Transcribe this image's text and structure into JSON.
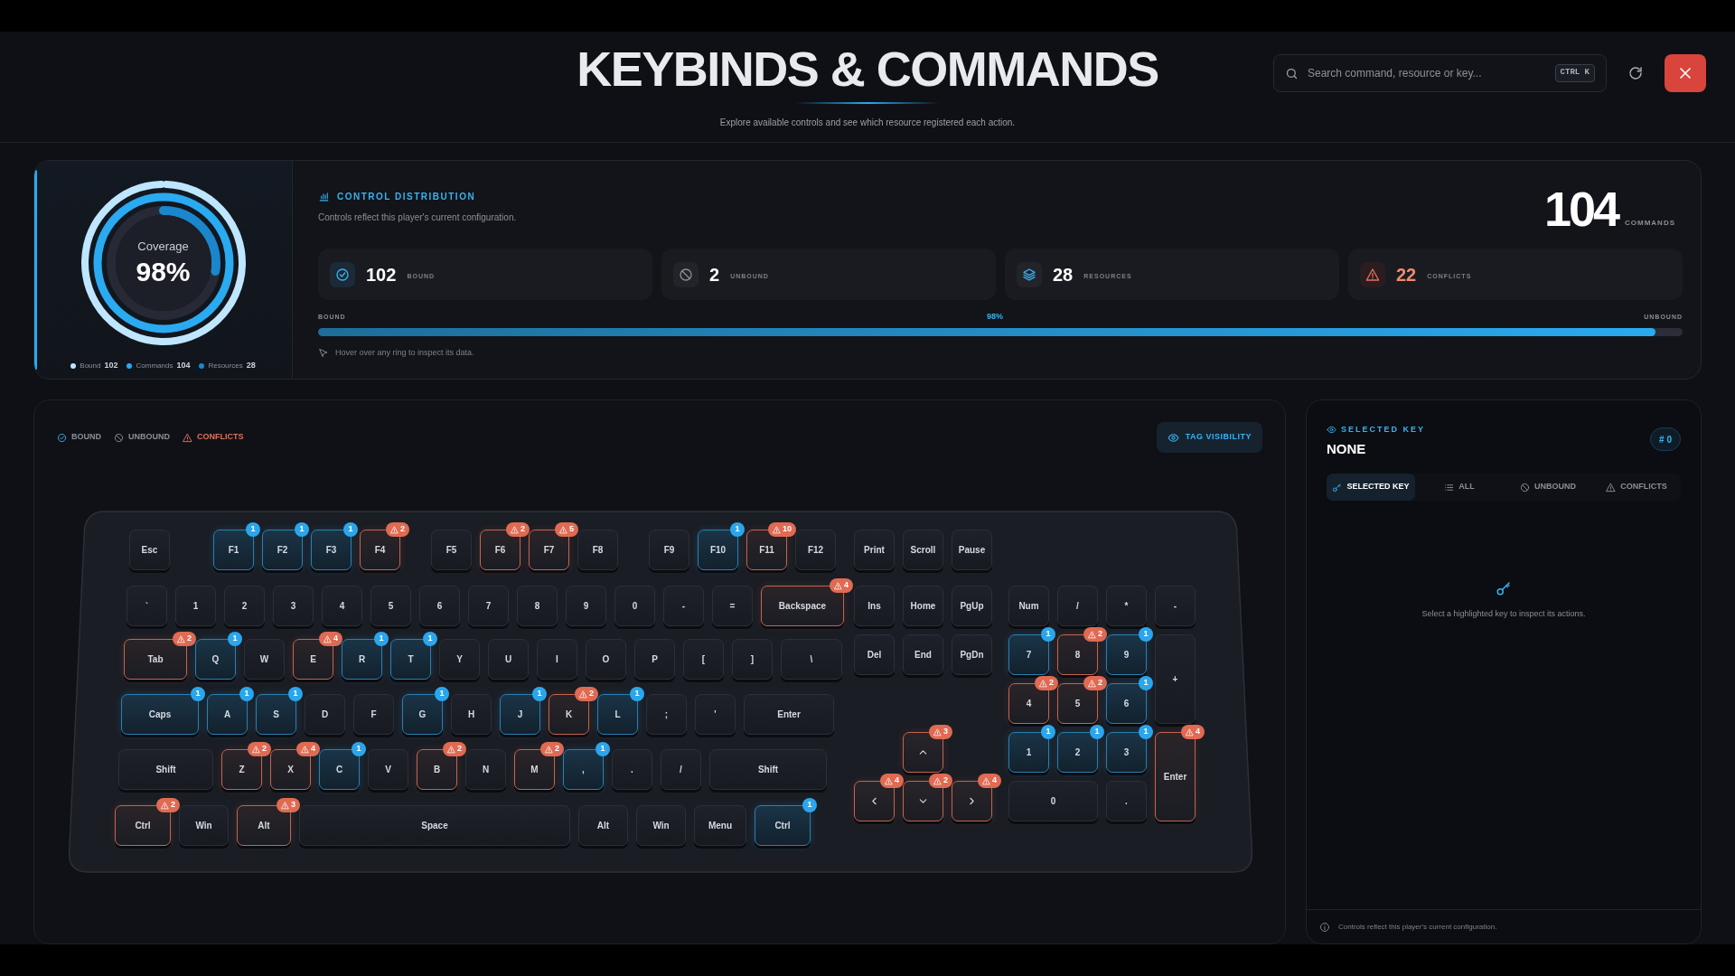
{
  "header": {
    "title": "KEYBINDS & COMMANDS",
    "subtitle": "Explore available controls and see which resource registered each action.",
    "search": {
      "placeholder": "Search command, resource or key...",
      "shortcut": "CTRL K"
    }
  },
  "overview": {
    "coverage": {
      "label": "Coverage",
      "value": "98%"
    },
    "legend": [
      {
        "label": "Bound",
        "value": "102",
        "color": "#bfe6ff"
      },
      {
        "label": "Commands",
        "value": "104",
        "color": "#2aaaf0"
      },
      {
        "label": "Resources",
        "value": "28",
        "color": "#1a86cc"
      }
    ],
    "title": "CONTROL DISTRIBUTION",
    "subtitle": "Controls reflect this player's current configuration.",
    "total": {
      "value": "104",
      "label": "COMMANDS"
    },
    "stats": [
      {
        "kind": "bound",
        "value": "102",
        "label": "BOUND"
      },
      {
        "kind": "unbound",
        "value": "2",
        "label": "UNBOUND"
      },
      {
        "kind": "resources",
        "value": "28",
        "label": "RESOURCES"
      },
      {
        "kind": "conflicts",
        "value": "22",
        "label": "CONFLICTS"
      }
    ],
    "progress": {
      "start_label": "BOUND",
      "reading": "98%",
      "end_label": "UNBOUND",
      "level": 0.98
    },
    "hint": "Hover over any ring to inspect its data."
  },
  "keyboard": {
    "legend": [
      {
        "kind": "bound",
        "label": "BOUND"
      },
      {
        "kind": "unbound",
        "label": "UNBOUND"
      },
      {
        "kind": "conflicts",
        "label": "CONFLICTS"
      }
    ],
    "tag_button": "TAG VISIBILITY",
    "main_rows": [
      [
        {
          "label": "Esc",
          "kind": "none"
        },
        {
          "label": "F1",
          "kind": "bound",
          "count": "1"
        },
        {
          "label": "F2",
          "kind": "bound",
          "count": "1"
        },
        {
          "label": "F3",
          "kind": "bound",
          "count": "1"
        },
        {
          "label": "F4",
          "kind": "conflict",
          "count": "2"
        },
        {
          "label": "F5",
          "kind": "none"
        },
        {
          "label": "F6",
          "kind": "conflict",
          "count": "2"
        },
        {
          "label": "F7",
          "kind": "conflict",
          "count": "5"
        },
        {
          "label": "F8",
          "kind": "none"
        },
        {
          "label": "F9",
          "kind": "none"
        },
        {
          "label": "F10",
          "kind": "bound",
          "count": "1"
        },
        {
          "label": "F11",
          "kind": "conflict",
          "count": "10"
        },
        {
          "label": "F12",
          "kind": "none"
        }
      ],
      [
        {
          "label": "`",
          "kind": "none"
        },
        {
          "label": "1",
          "kind": "none"
        },
        {
          "label": "2",
          "kind": "none"
        },
        {
          "label": "3",
          "kind": "none"
        },
        {
          "label": "4",
          "kind": "none"
        },
        {
          "label": "5",
          "kind": "none"
        },
        {
          "label": "6",
          "kind": "none"
        },
        {
          "label": "7",
          "kind": "none"
        },
        {
          "label": "8",
          "kind": "none"
        },
        {
          "label": "9",
          "kind": "none"
        },
        {
          "label": "0",
          "kind": "none"
        },
        {
          "label": "-",
          "kind": "none"
        },
        {
          "label": "=",
          "kind": "none"
        },
        {
          "label": "Backspace",
          "kind": "conflict",
          "count": "4"
        }
      ],
      [
        {
          "label": "Tab",
          "kind": "conflict",
          "count": "2"
        },
        {
          "label": "Q",
          "kind": "bound",
          "count": "1"
        },
        {
          "label": "W",
          "kind": "none"
        },
        {
          "label": "E",
          "kind": "conflict",
          "count": "4"
        },
        {
          "label": "R",
          "kind": "bound",
          "count": "1"
        },
        {
          "label": "T",
          "kind": "bound",
          "count": "1"
        },
        {
          "label": "Y",
          "kind": "none"
        },
        {
          "label": "U",
          "kind": "none"
        },
        {
          "label": "I",
          "kind": "none"
        },
        {
          "label": "O",
          "kind": "none"
        },
        {
          "label": "P",
          "kind": "none"
        },
        {
          "label": "[",
          "kind": "none"
        },
        {
          "label": "]",
          "kind": "none"
        },
        {
          "label": "\\",
          "kind": "none"
        }
      ],
      [
        {
          "label": "Caps",
          "kind": "bound",
          "count": "1"
        },
        {
          "label": "A",
          "kind": "bound",
          "count": "1"
        },
        {
          "label": "S",
          "kind": "bound",
          "count": "1"
        },
        {
          "label": "D",
          "kind": "none"
        },
        {
          "label": "F",
          "kind": "none"
        },
        {
          "label": "G",
          "kind": "bound",
          "count": "1"
        },
        {
          "label": "H",
          "kind": "none"
        },
        {
          "label": "J",
          "kind": "bound",
          "count": "1"
        },
        {
          "label": "K",
          "kind": "conflict",
          "count": "2"
        },
        {
          "label": "L",
          "kind": "bound",
          "count": "1"
        },
        {
          "label": ";",
          "kind": "none"
        },
        {
          "label": "'",
          "kind": "none"
        },
        {
          "label": "Enter",
          "kind": "none"
        }
      ],
      [
        {
          "label": "Shift",
          "kind": "none"
        },
        {
          "label": "Z",
          "kind": "conflict",
          "count": "2"
        },
        {
          "label": "X",
          "kind": "conflict",
          "count": "4"
        },
        {
          "label": "C",
          "kind": "bound",
          "count": "1"
        },
        {
          "label": "V",
          "kind": "none"
        },
        {
          "label": "B",
          "kind": "conflict",
          "count": "2"
        },
        {
          "label": "N",
          "kind": "none"
        },
        {
          "label": "M",
          "kind": "conflict",
          "count": "2"
        },
        {
          "label": ",",
          "kind": "bound",
          "count": "1"
        },
        {
          "label": ".",
          "kind": "none"
        },
        {
          "label": "/",
          "kind": "none"
        },
        {
          "label": "Shift",
          "kind": "none"
        }
      ],
      [
        {
          "label": "Ctrl",
          "kind": "conflict",
          "count": "2"
        },
        {
          "label": "Win",
          "kind": "none"
        },
        {
          "label": "Alt",
          "kind": "conflict",
          "count": "3"
        },
        {
          "label": "Space",
          "kind": "none"
        },
        {
          "label": "Alt",
          "kind": "none"
        },
        {
          "label": "Win",
          "kind": "none"
        },
        {
          "label": "Menu",
          "kind": "none"
        },
        {
          "label": "Ctrl",
          "kind": "bound",
          "count": "1"
        }
      ]
    ],
    "system_keys": [
      {
        "label": "Print",
        "kind": "none"
      },
      {
        "label": "Scroll",
        "kind": "none"
      },
      {
        "label": "Pause",
        "kind": "none"
      }
    ],
    "nav_keys": [
      {
        "label": "Ins",
        "kind": "none"
      },
      {
        "label": "Home",
        "kind": "none"
      },
      {
        "label": "PgUp",
        "kind": "none"
      },
      {
        "label": "Del",
        "kind": "none"
      },
      {
        "label": "End",
        "kind": "none"
      },
      {
        "label": "PgDn",
        "kind": "none"
      }
    ],
    "arrow_keys": [
      {
        "kind": "conflict",
        "count": "3"
      },
      {
        "kind": "conflict",
        "count": "4"
      },
      {
        "kind": "conflict",
        "count": "2"
      },
      {
        "kind": "conflict",
        "count": "4"
      }
    ],
    "numpad_keys": [
      {
        "label": "Num",
        "kind": "none"
      },
      {
        "label": "/",
        "kind": "none"
      },
      {
        "label": "*",
        "kind": "none"
      },
      {
        "label": "-",
        "kind": "none"
      },
      {
        "label": "7",
        "kind": "bound",
        "count": "1"
      },
      {
        "label": "8",
        "kind": "conflict",
        "count": "2"
      },
      {
        "label": "9",
        "kind": "bound",
        "count": "1"
      },
      {
        "label": "+",
        "kind": "none"
      },
      {
        "label": "4",
        "kind": "conflict",
        "count": "2"
      },
      {
        "label": "5",
        "kind": "conflict",
        "count": "2"
      },
      {
        "label": "6",
        "kind": "bound",
        "count": "1"
      },
      {
        "label": "1",
        "kind": "bound",
        "count": "1"
      },
      {
        "label": "2",
        "kind": "bound",
        "count": "1"
      },
      {
        "label": "3",
        "kind": "bound",
        "count": "1"
      },
      {
        "label": "Enter",
        "kind": "conflict",
        "count": "4"
      },
      {
        "label": "0",
        "kind": "none"
      },
      {
        "label": ".",
        "kind": "none"
      }
    ]
  },
  "selected_panel": {
    "title": "SELECTED KEY",
    "key": "NONE",
    "count": "# 0",
    "tabs": [
      {
        "kind": "selected",
        "label": "SELECTED KEY",
        "selected": true
      },
      {
        "kind": "all",
        "label": "ALL",
        "selected": false
      },
      {
        "kind": "unbound",
        "label": "UNBOUND",
        "selected": false
      },
      {
        "kind": "conflicts",
        "label": "CONFLICTS",
        "selected": false
      }
    ],
    "empty_text": "Select a highlighted key to inspect its actions.",
    "footer": "Controls reflect this player's current configuration."
  }
}
